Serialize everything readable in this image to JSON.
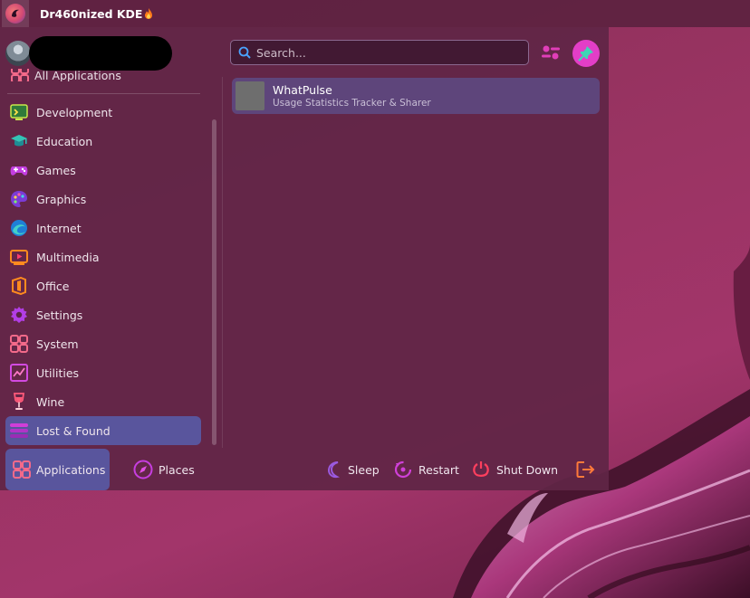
{
  "panel": {
    "title": "Dr460nized KDE",
    "launcher_icon": "dragon-logo-icon",
    "flame_icon": "flame-icon"
  },
  "menu": {
    "user": {
      "avatar_icon": "user-avatar",
      "name_redacted": true
    },
    "search": {
      "placeholder": "Search...",
      "value": ""
    },
    "categories": [
      {
        "label": "All Applications",
        "icon": "all-applications-icon",
        "partially_hidden": true
      },
      {
        "label": "Development",
        "icon": "development-icon"
      },
      {
        "label": "Education",
        "icon": "education-icon"
      },
      {
        "label": "Games",
        "icon": "games-icon"
      },
      {
        "label": "Graphics",
        "icon": "graphics-icon"
      },
      {
        "label": "Internet",
        "icon": "internet-icon"
      },
      {
        "label": "Multimedia",
        "icon": "multimedia-icon"
      },
      {
        "label": "Office",
        "icon": "office-icon"
      },
      {
        "label": "Settings",
        "icon": "settings-icon"
      },
      {
        "label": "System",
        "icon": "system-icon"
      },
      {
        "label": "Utilities",
        "icon": "utilities-icon"
      },
      {
        "label": "Wine",
        "icon": "wine-icon"
      },
      {
        "label": "Lost & Found",
        "icon": "lost-found-icon",
        "active": true
      }
    ],
    "results": [
      {
        "name": "WhatPulse",
        "description": "Usage Statistics Tracker & Sharer"
      }
    ],
    "tabs": {
      "applications": "Applications",
      "places": "Places"
    },
    "power": {
      "sleep": "Sleep",
      "restart": "Restart",
      "shutdown": "Shut Down",
      "logout_icon": "logout-icon"
    }
  },
  "colors": {
    "accent_pink": "#e33ec7",
    "active_item": "#585ca8",
    "panel_bg": "#5c2240"
  }
}
